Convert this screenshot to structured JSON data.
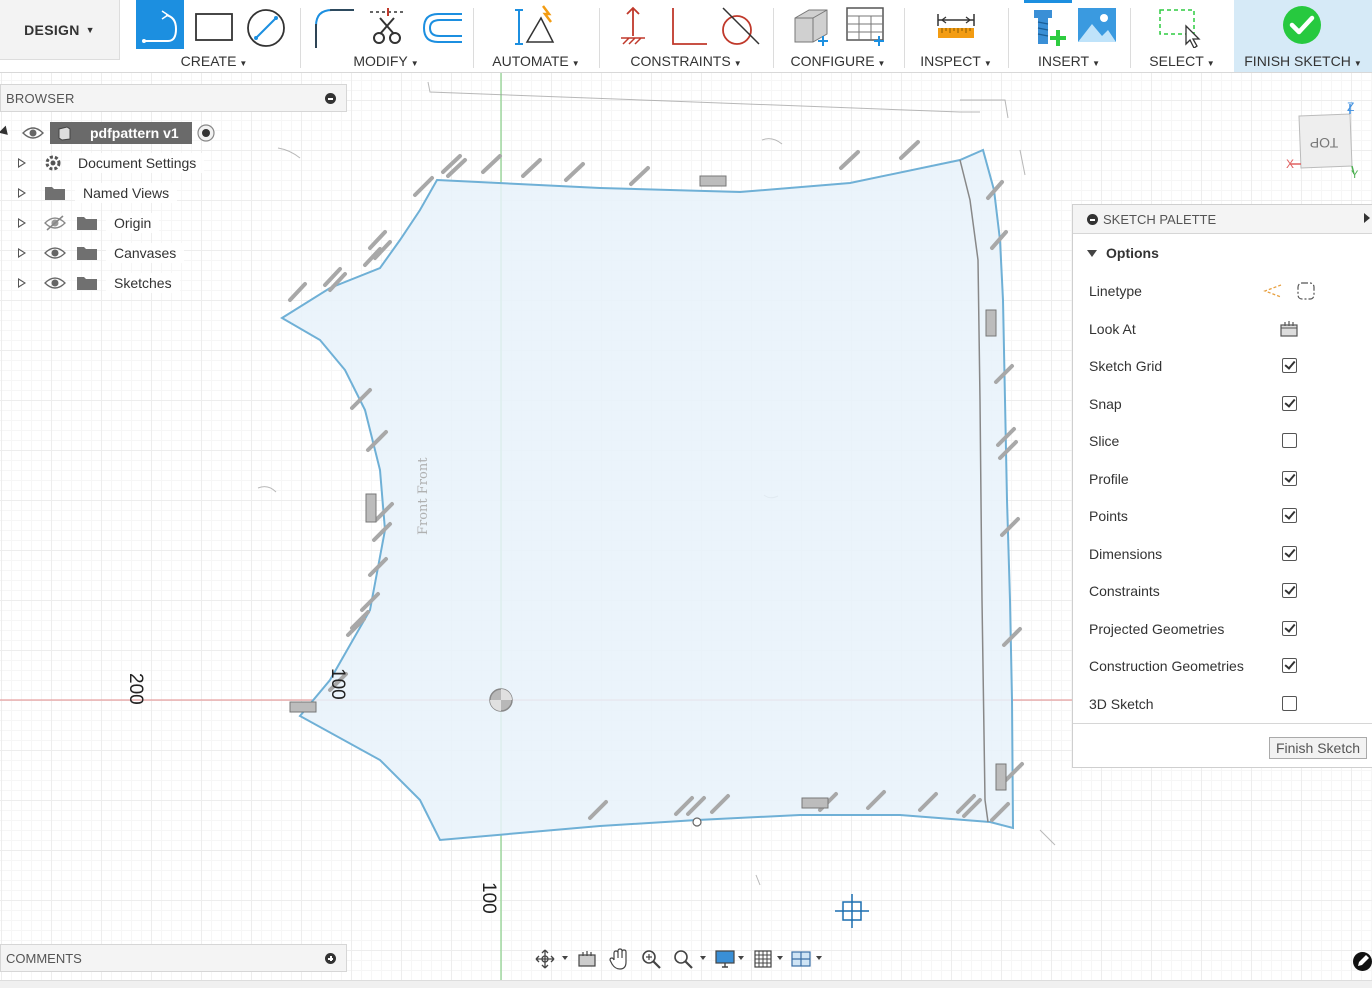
{
  "toolbar": {
    "workspace_label": "DESIGN",
    "groups": {
      "create": "CREATE",
      "modify": "MODIFY",
      "automate": "AUTOMATE",
      "constraints": "CONSTRAINTS",
      "configure": "CONFIGURE",
      "inspect": "INSPECT",
      "insert": "INSERT",
      "select": "SELECT",
      "finish": "FINISH SKETCH"
    }
  },
  "browser": {
    "title": "BROWSER",
    "root": "pdfpattern v1",
    "items": [
      {
        "label": "Document Settings",
        "icon": "gear-icon"
      },
      {
        "label": "Named Views",
        "icon": "folder-icon"
      },
      {
        "label": "Origin",
        "icon": "folder-icon",
        "hidden": true
      },
      {
        "label": "Canvases",
        "icon": "folder-icon"
      },
      {
        "label": "Sketches",
        "icon": "folder-icon"
      }
    ]
  },
  "palette": {
    "title": "SKETCH PALETTE",
    "section": "Options",
    "linetype_label": "Linetype",
    "lookat_label": "Look At",
    "options": [
      {
        "label": "Sketch Grid",
        "checked": true
      },
      {
        "label": "Snap",
        "checked": true
      },
      {
        "label": "Slice",
        "checked": false
      },
      {
        "label": "Profile",
        "checked": true
      },
      {
        "label": "Points",
        "checked": true
      },
      {
        "label": "Dimensions",
        "checked": true
      },
      {
        "label": "Constraints",
        "checked": true
      },
      {
        "label": "Projected Geometries",
        "checked": true
      },
      {
        "label": "Construction Geometries",
        "checked": true
      },
      {
        "label": "3D Sketch",
        "checked": false
      }
    ],
    "finish_button": "Finish Sketch"
  },
  "canvas": {
    "axis_labels": [
      "200",
      "100",
      "100"
    ],
    "pattern_text": "Front Front"
  },
  "viewcube": {
    "face": "TOP",
    "axes": [
      "Z",
      "X",
      "Y"
    ]
  },
  "comments": {
    "title": "COMMENTS"
  },
  "colors": {
    "accent": "#1c8fe0",
    "finish_bg": "#d6eaf7",
    "sketch_fill": "#e8f2fa",
    "sketch_line": "#6fb0d6",
    "x_axis": "#e8a0a0",
    "y_axis": "#8ad08a"
  }
}
